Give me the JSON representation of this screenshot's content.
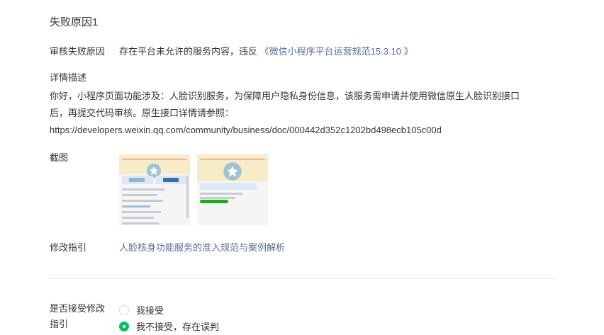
{
  "section": {
    "title": "失败原因1"
  },
  "reason": {
    "label": "审核失败原因",
    "text": "存在平台未允许的服务内容，违反",
    "link": "《微信小程序平台运营规范15.3.10 》"
  },
  "detail": {
    "label": "详情描述",
    "line1": "你好，小程序页面功能涉及：人脸识别服务，为保障用户隐私身份信息，该服务需申请并使用微信原生人脸识别接口",
    "line2": "后，再提交代码审核。原生接口详情请参照：",
    "line3": "https://developers.weixin.qq.com/community/business/doc/000442d352c1202bd498ecb105c00d"
  },
  "screenshots": {
    "label": "截图"
  },
  "guide": {
    "label": "修改指引",
    "link": "人脸核身功能服务的准入规范与案例解析"
  },
  "accept": {
    "label_line1": "是否接受修改",
    "label_line2": "指引",
    "options": [
      {
        "label": "我接受",
        "checked": false
      },
      {
        "label": "我不接受，存在误判",
        "checked": true
      }
    ]
  },
  "colors": {
    "link": "#576b95",
    "radio_checked": "#07c160"
  }
}
